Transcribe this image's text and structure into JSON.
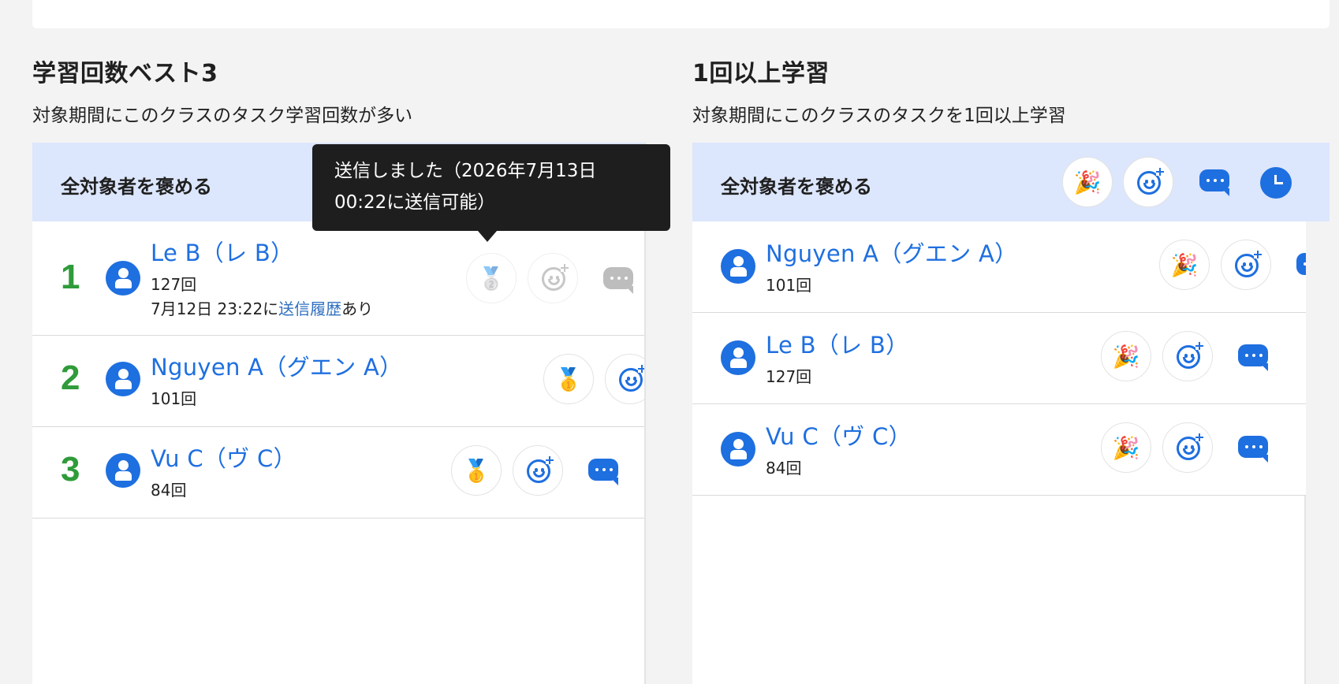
{
  "left_section": {
    "title": "学習回数ベスト3",
    "description": "対象期間にこのクラスのタスク学習回数が多い",
    "praise_all_label": "全対象者を褒める",
    "rows": [
      {
        "rank": "1",
        "name": "Le B（レ B）",
        "count": "127回",
        "history_prefix": "7月12日 23:22に",
        "history_link": "送信履歴",
        "history_suffix": "あり",
        "medal": "🥈"
      },
      {
        "rank": "2",
        "name": "Nguyen A（グエン A）",
        "count": "101回",
        "medal": "🥇"
      },
      {
        "rank": "3",
        "name": "Vu C（ヴ C）",
        "count": "84回",
        "medal": "🥇"
      }
    ]
  },
  "right_section": {
    "title": "1回以上学習",
    "description": "対象期間にこのクラスのタスクを1回以上学習",
    "praise_all_label": "全対象者を褒める",
    "header_party": "🎉",
    "rows": [
      {
        "name": "Nguyen A（グエン A）",
        "count": "101回",
        "party": "🎉"
      },
      {
        "name": "Le B（レ B）",
        "count": "127回",
        "party": "🎉"
      },
      {
        "name": "Vu C（ヴ C）",
        "count": "84回",
        "party": "🎉"
      }
    ]
  },
  "tooltip": {
    "line1": "送信しました（2026年7月13日",
    "line2": "00:22に送信可能）"
  },
  "colors": {
    "accent": "#1e6fe0",
    "rank": "#2f9b3a",
    "header_bg": "#dce6fc"
  }
}
